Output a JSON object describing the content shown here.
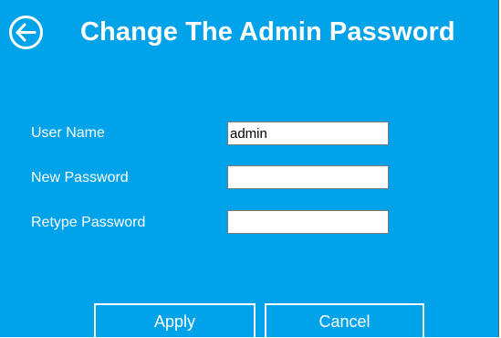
{
  "header": {
    "title": "Change The Admin Password",
    "back_icon": "back-arrow-circle-icon"
  },
  "form": {
    "username_label": "User Name",
    "username_value": "admin",
    "new_password_label": "New Password",
    "new_password_value": "",
    "retype_password_label": "Retype Password",
    "retype_password_value": ""
  },
  "buttons": {
    "apply_label": "Apply",
    "cancel_label": "Cancel"
  },
  "colors": {
    "background": "#00a2ea",
    "text": "#ffffff",
    "input_background": "#ffffff"
  }
}
